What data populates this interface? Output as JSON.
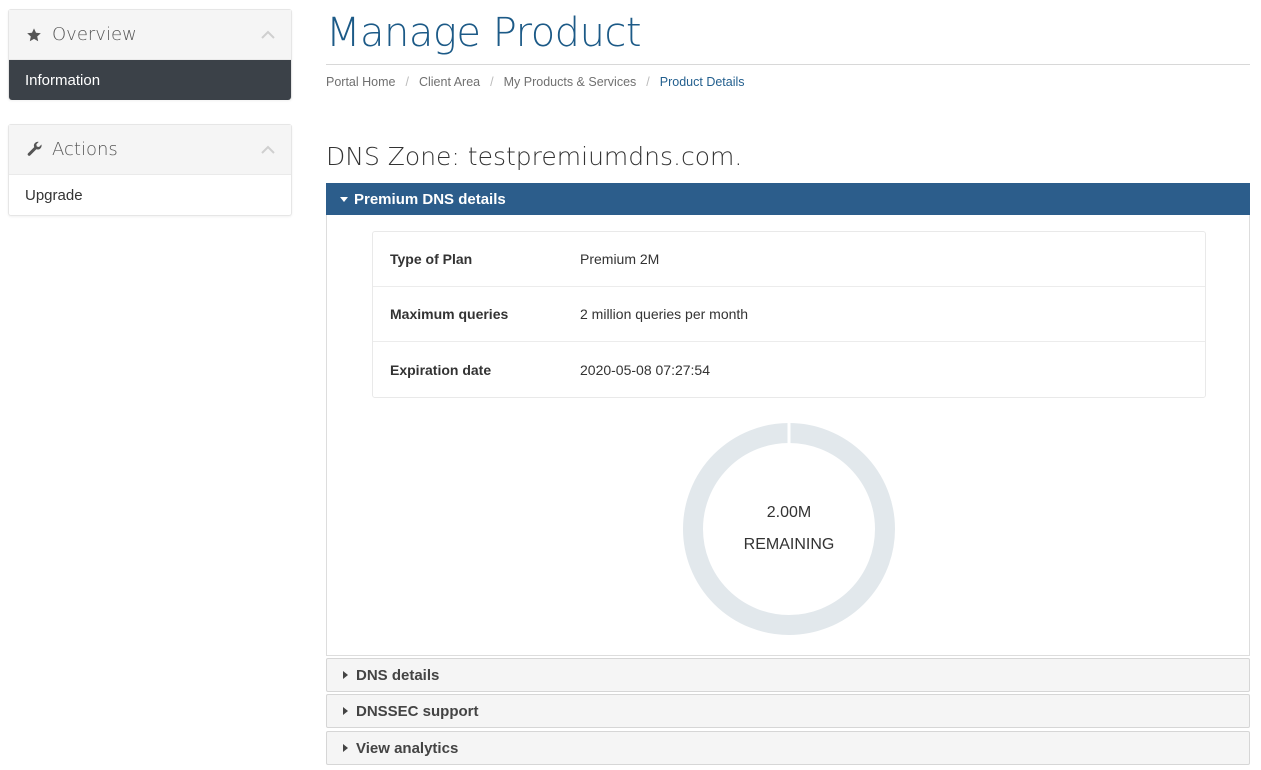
{
  "sidebar": {
    "overview": {
      "title": "Overview",
      "icon": "star-icon",
      "items": [
        {
          "label": "Information",
          "active": true
        }
      ]
    },
    "actions": {
      "title": "Actions",
      "icon": "wrench-icon",
      "items": [
        {
          "label": "Upgrade",
          "active": false
        }
      ]
    }
  },
  "header": {
    "title": "Manage Product",
    "breadcrumb": [
      {
        "label": "Portal Home"
      },
      {
        "label": "Client Area"
      },
      {
        "label": "My Products & Services"
      },
      {
        "label": "Product Details",
        "active": true
      }
    ]
  },
  "main": {
    "zone_title": "DNS Zone: testpremiumdns.com.",
    "premium_panel": {
      "title": "Premium DNS details",
      "rows": [
        {
          "label": "Type of Plan",
          "value": "Premium 2M"
        },
        {
          "label": "Maximum queries",
          "value": "2 million queries per month"
        },
        {
          "label": "Expiration date",
          "value": "2020-05-08 07:27:54"
        }
      ],
      "usage": {
        "value": "2.00M",
        "caption": "REMAINING"
      }
    },
    "collapsed_panels": [
      {
        "label": "DNS details"
      },
      {
        "label": "DNSSEC support"
      },
      {
        "label": "View analytics"
      }
    ]
  },
  "colors": {
    "accent": "#2c5d8b",
    "title": "#1c5a87",
    "sidebar_active": "#3b4148",
    "ring": "#e2e8ec"
  }
}
